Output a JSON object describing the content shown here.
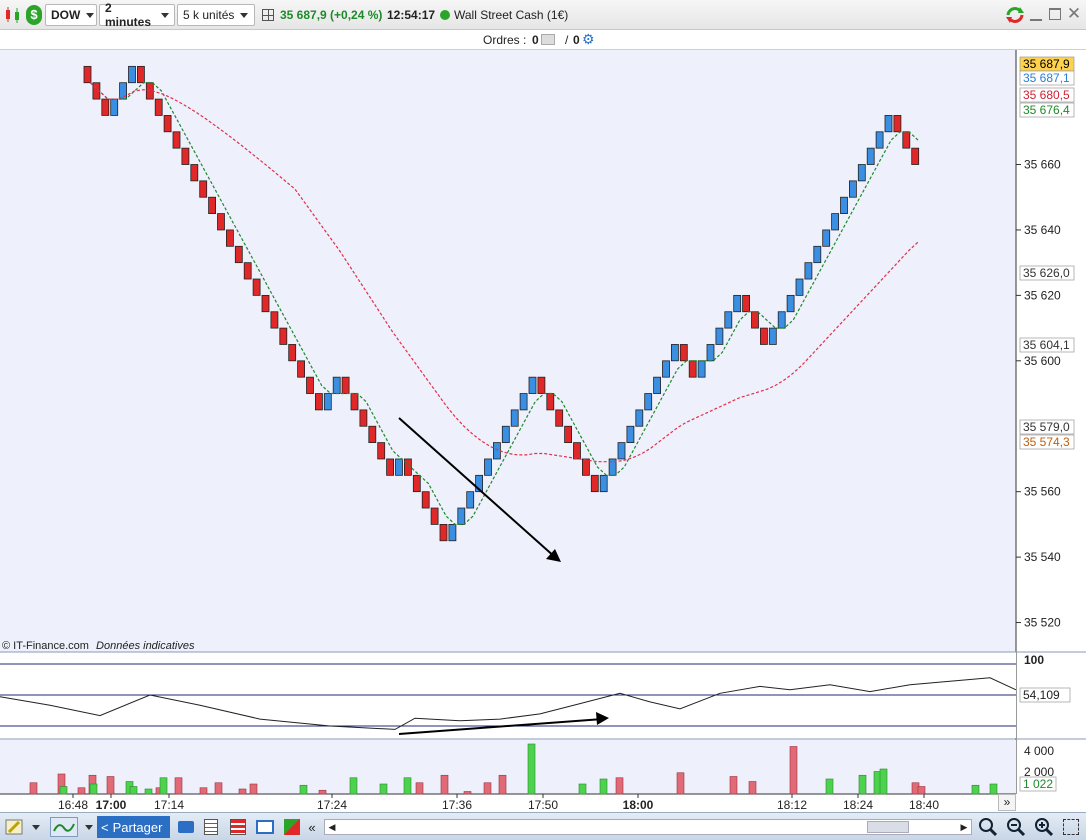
{
  "toolbar": {
    "instrument": "DOW",
    "timeframe": "2 minutes",
    "units": "5 k unités",
    "price_change": "35 687,9 (+0,24 %)",
    "time": "12:54:17",
    "market_name": "Wall Street Cash (1€)",
    "status_color": "#2aa52a"
  },
  "orders": {
    "label": "Ordres :",
    "count1": "0",
    "sep": "/",
    "count2": "0"
  },
  "chart": {
    "copyright": "© IT-Finance.com",
    "disclaimer": "Données indicatives",
    "price_axis_ticks": [
      "35 660",
      "35 640",
      "35 620",
      "35 600",
      "35 560",
      "35 540",
      "35 520"
    ],
    "price_badges": [
      {
        "value": "35 687,9",
        "bg": "#ffd24d",
        "fg": "#000"
      },
      {
        "value": "35 687,1",
        "bg": "#ffffff",
        "fg": "#2a7fd4"
      },
      {
        "value": "35 680,5",
        "bg": "#ffffff",
        "fg": "#cc2233"
      },
      {
        "value": "35 676,4",
        "bg": "#ffffff",
        "fg": "#1e8a2a"
      },
      {
        "value": "35 626,0",
        "bg": "#ffffff",
        "fg": "#333"
      },
      {
        "value": "35 604,1",
        "bg": "#ffffff",
        "fg": "#333"
      },
      {
        "value": "35 579,0",
        "bg": "#ffffff",
        "fg": "#333"
      },
      {
        "value": "35 574,3",
        "bg": "#ffffff",
        "fg": "#c06010"
      }
    ],
    "osc_ticks": [
      "100"
    ],
    "osc_value": "54,109",
    "vol_ticks": [
      "4 000",
      "2 000"
    ],
    "vol_value": "1 022",
    "time_labels": [
      "16:48",
      "17:00",
      "17:14",
      "17:24",
      "17:36",
      "17:50",
      "18:00",
      "18:12",
      "18:24",
      "18:40"
    ],
    "time_bold": [
      "17:00",
      "18:00"
    ]
  },
  "chart_data": {
    "type": "renko",
    "brick_size": 5,
    "bricks": [
      {
        "d": "down",
        "o": 35690,
        "c": 35685
      },
      {
        "d": "down",
        "o": 35685,
        "c": 35680
      },
      {
        "d": "down",
        "o": 35680,
        "c": 35675
      },
      {
        "d": "up",
        "o": 35675,
        "c": 35680
      },
      {
        "d": "up",
        "o": 35680,
        "c": 35685
      },
      {
        "d": "up",
        "o": 35685,
        "c": 35690
      },
      {
        "d": "down",
        "o": 35690,
        "c": 35685
      },
      {
        "d": "down",
        "o": 35685,
        "c": 35680
      },
      {
        "d": "down",
        "o": 35680,
        "c": 35675
      },
      {
        "d": "down",
        "o": 35675,
        "c": 35670
      },
      {
        "d": "down",
        "o": 35670,
        "c": 35665
      },
      {
        "d": "down",
        "o": 35665,
        "c": 35660
      },
      {
        "d": "down",
        "o": 35660,
        "c": 35655
      },
      {
        "d": "down",
        "o": 35655,
        "c": 35650
      },
      {
        "d": "down",
        "o": 35650,
        "c": 35645
      },
      {
        "d": "down",
        "o": 35645,
        "c": 35640
      },
      {
        "d": "down",
        "o": 35640,
        "c": 35635
      },
      {
        "d": "down",
        "o": 35635,
        "c": 35630
      },
      {
        "d": "down",
        "o": 35630,
        "c": 35625
      },
      {
        "d": "down",
        "o": 35625,
        "c": 35620
      },
      {
        "d": "down",
        "o": 35620,
        "c": 35615
      },
      {
        "d": "down",
        "o": 35615,
        "c": 35610
      },
      {
        "d": "down",
        "o": 35610,
        "c": 35605
      },
      {
        "d": "down",
        "o": 35605,
        "c": 35600
      },
      {
        "d": "down",
        "o": 35600,
        "c": 35595
      },
      {
        "d": "down",
        "o": 35595,
        "c": 35590
      },
      {
        "d": "down",
        "o": 35590,
        "c": 35585
      },
      {
        "d": "up",
        "o": 35585,
        "c": 35590
      },
      {
        "d": "up",
        "o": 35590,
        "c": 35595
      },
      {
        "d": "down",
        "o": 35595,
        "c": 35590
      },
      {
        "d": "down",
        "o": 35590,
        "c": 35585
      },
      {
        "d": "down",
        "o": 35585,
        "c": 35580
      },
      {
        "d": "down",
        "o": 35580,
        "c": 35575
      },
      {
        "d": "down",
        "o": 35575,
        "c": 35570
      },
      {
        "d": "down",
        "o": 35570,
        "c": 35565
      },
      {
        "d": "up",
        "o": 35565,
        "c": 35570
      },
      {
        "d": "down",
        "o": 35570,
        "c": 35565
      },
      {
        "d": "down",
        "o": 35565,
        "c": 35560
      },
      {
        "d": "down",
        "o": 35560,
        "c": 35555
      },
      {
        "d": "down",
        "o": 35555,
        "c": 35550
      },
      {
        "d": "down",
        "o": 35550,
        "c": 35545
      },
      {
        "d": "up",
        "o": 35545,
        "c": 35550
      },
      {
        "d": "up",
        "o": 35550,
        "c": 35555
      },
      {
        "d": "up",
        "o": 35555,
        "c": 35560
      },
      {
        "d": "up",
        "o": 35560,
        "c": 35565
      },
      {
        "d": "up",
        "o": 35565,
        "c": 35570
      },
      {
        "d": "up",
        "o": 35570,
        "c": 35575
      },
      {
        "d": "up",
        "o": 35575,
        "c": 35580
      },
      {
        "d": "up",
        "o": 35580,
        "c": 35585
      },
      {
        "d": "up",
        "o": 35585,
        "c": 35590
      },
      {
        "d": "up",
        "o": 35590,
        "c": 35595
      },
      {
        "d": "down",
        "o": 35595,
        "c": 35590
      },
      {
        "d": "down",
        "o": 35590,
        "c": 35585
      },
      {
        "d": "down",
        "o": 35585,
        "c": 35580
      },
      {
        "d": "down",
        "o": 35580,
        "c": 35575
      },
      {
        "d": "down",
        "o": 35575,
        "c": 35570
      },
      {
        "d": "down",
        "o": 35570,
        "c": 35565
      },
      {
        "d": "down",
        "o": 35565,
        "c": 35560
      },
      {
        "d": "up",
        "o": 35560,
        "c": 35565
      },
      {
        "d": "up",
        "o": 35565,
        "c": 35570
      },
      {
        "d": "up",
        "o": 35570,
        "c": 35575
      },
      {
        "d": "up",
        "o": 35575,
        "c": 35580
      },
      {
        "d": "up",
        "o": 35580,
        "c": 35585
      },
      {
        "d": "up",
        "o": 35585,
        "c": 35590
      },
      {
        "d": "up",
        "o": 35590,
        "c": 35595
      },
      {
        "d": "up",
        "o": 35595,
        "c": 35600
      },
      {
        "d": "up",
        "o": 35600,
        "c": 35605
      },
      {
        "d": "down",
        "o": 35605,
        "c": 35600
      },
      {
        "d": "down",
        "o": 35600,
        "c": 35595
      },
      {
        "d": "up",
        "o": 35595,
        "c": 35600
      },
      {
        "d": "up",
        "o": 35600,
        "c": 35605
      },
      {
        "d": "up",
        "o": 35605,
        "c": 35610
      },
      {
        "d": "up",
        "o": 35610,
        "c": 35615
      },
      {
        "d": "up",
        "o": 35615,
        "c": 35620
      },
      {
        "d": "down",
        "o": 35620,
        "c": 35615
      },
      {
        "d": "down",
        "o": 35615,
        "c": 35610
      },
      {
        "d": "down",
        "o": 35610,
        "c": 35605
      },
      {
        "d": "up",
        "o": 35605,
        "c": 35610
      },
      {
        "d": "up",
        "o": 35610,
        "c": 35615
      },
      {
        "d": "up",
        "o": 35615,
        "c": 35620
      },
      {
        "d": "up",
        "o": 35620,
        "c": 35625
      },
      {
        "d": "up",
        "o": 35625,
        "c": 35630
      },
      {
        "d": "up",
        "o": 35630,
        "c": 35635
      },
      {
        "d": "up",
        "o": 35635,
        "c": 35640
      },
      {
        "d": "up",
        "o": 35640,
        "c": 35645
      },
      {
        "d": "up",
        "o": 35645,
        "c": 35650
      },
      {
        "d": "up",
        "o": 35650,
        "c": 35655
      },
      {
        "d": "up",
        "o": 35655,
        "c": 35660
      },
      {
        "d": "up",
        "o": 35660,
        "c": 35665
      },
      {
        "d": "up",
        "o": 35665,
        "c": 35670
      },
      {
        "d": "up",
        "o": 35670,
        "c": 35675
      },
      {
        "d": "down",
        "o": 35675,
        "c": 35670
      },
      {
        "d": "down",
        "o": 35670,
        "c": 35665
      },
      {
        "d": "down",
        "o": 35665,
        "c": 35660
      }
    ],
    "ylim": [
      35511,
      35695
    ],
    "colors": {
      "up": "#3a8fe3",
      "down": "#e02828",
      "ma_fast": "#1e8a2a",
      "ma_slow": "#e0304a"
    },
    "volumes": [
      {
        "v": 900,
        "c": "red"
      },
      {
        "v": 1600,
        "c": "red"
      },
      {
        "v": 500,
        "c": "red"
      },
      {
        "v": 1500,
        "c": "red"
      },
      {
        "v": 1400,
        "c": "red"
      },
      {
        "v": 1000,
        "c": "green"
      },
      {
        "v": 400,
        "c": "green"
      },
      {
        "v": 500,
        "c": "red"
      },
      {
        "v": 1300,
        "c": "red"
      },
      {
        "v": 900,
        "c": "red"
      },
      {
        "v": 400,
        "c": "red"
      },
      {
        "v": 300,
        "c": "red"
      },
      {
        "v": 1300,
        "c": "green"
      },
      {
        "v": 900,
        "c": "red"
      },
      {
        "v": 1500,
        "c": "red"
      },
      {
        "v": 200,
        "c": "red"
      },
      {
        "v": 900,
        "c": "red"
      },
      {
        "v": 1500,
        "c": "red"
      },
      {
        "v": 4000,
        "c": "green"
      },
      {
        "v": 800,
        "c": "green"
      },
      {
        "v": 1300,
        "c": "red"
      },
      {
        "v": 1700,
        "c": "red"
      },
      {
        "v": 1400,
        "c": "red"
      },
      {
        "v": 1000,
        "c": "red"
      },
      {
        "v": 3800,
        "c": "red"
      },
      {
        "v": 1200,
        "c": "green"
      },
      {
        "v": 1500,
        "c": "green"
      },
      {
        "v": 1800,
        "c": "green"
      },
      {
        "v": 900,
        "c": "red"
      },
      {
        "v": 600,
        "c": "red"
      },
      {
        "v": 700,
        "c": "green"
      },
      {
        "v": 800,
        "c": "green"
      },
      {
        "v": 600,
        "c": "green"
      },
      {
        "v": 800,
        "c": "green"
      },
      {
        "v": 600,
        "c": "green"
      },
      {
        "v": 1300,
        "c": "green"
      },
      {
        "v": 500,
        "c": "red"
      },
      {
        "v": 800,
        "c": "red"
      },
      {
        "v": 700,
        "c": "green"
      },
      {
        "v": 1300,
        "c": "green"
      },
      {
        "v": 800,
        "c": "green"
      },
      {
        "v": 1200,
        "c": "green"
      },
      {
        "v": 2000,
        "c": "green"
      }
    ]
  },
  "bottom": {
    "share_label": "Partager"
  }
}
